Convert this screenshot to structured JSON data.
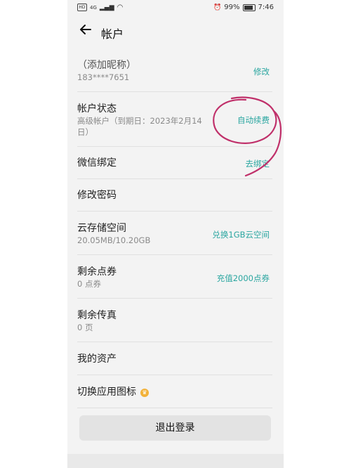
{
  "status_bar": {
    "hd": "HD",
    "network": "4G",
    "battery_percent": "99%",
    "time": "7:46"
  },
  "header": {
    "title": "帐户"
  },
  "profile": {
    "nickname": "（添加昵称）",
    "phone": "183****7651",
    "action": "修改"
  },
  "account_status": {
    "label": "帐户状态",
    "detail_line1": "高级帐户（到期日：2023年2月14",
    "detail_line2": "日）",
    "action": "自动续费"
  },
  "wechat": {
    "label": "微信绑定",
    "action": "去绑定"
  },
  "password": {
    "label": "修改密码"
  },
  "storage": {
    "label": "云存储空间",
    "detail": "20.05MB/10.20GB",
    "action": "兑换1GB云空间"
  },
  "coupons": {
    "label": "剩余点券",
    "detail": "0 点券",
    "action": "充值2000点券"
  },
  "fax": {
    "label": "剩余传真",
    "detail": "0 页"
  },
  "assets": {
    "label": "我的资产"
  },
  "app_icon": {
    "label": "切换应用图标"
  },
  "logout": {
    "label": "退出登录"
  },
  "colors": {
    "accent": "#2aa6a0",
    "annotation": "#c0306a"
  }
}
